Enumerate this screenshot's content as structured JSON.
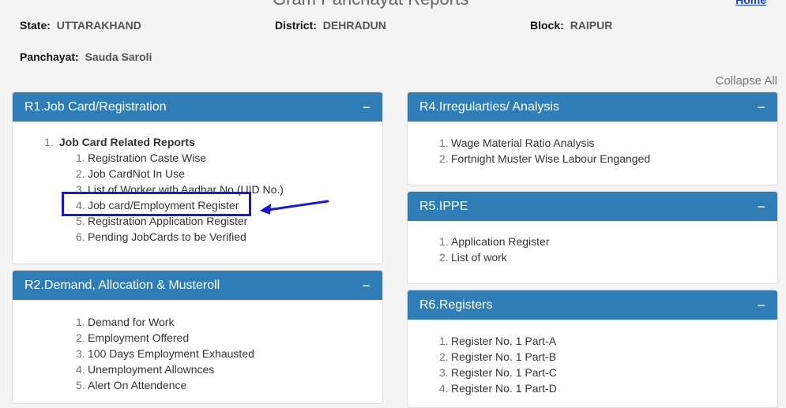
{
  "header": {
    "title": "Gram Panchayat Reports",
    "home_label": "Home"
  },
  "info": {
    "state_label": "State:",
    "state_value": "UTTARAKHAND",
    "district_label": "District:",
    "district_value": "DEHRADUN",
    "block_label": "Block:",
    "block_value": "RAIPUR",
    "panchayat_label": "Panchayat:",
    "panchayat_value": "Sauda Saroli"
  },
  "collapse_all_label": "Collapse All",
  "panels": {
    "r1": {
      "title": "R1.Job Card/Registration",
      "toggle": "−",
      "group": {
        "num": "1.",
        "title": "Job Card Related Reports"
      },
      "items": [
        {
          "num": "1.",
          "label": "Registration Caste Wise"
        },
        {
          "num": "2.",
          "label": "Job CardNot In Use"
        },
        {
          "num": "3.",
          "label": "List of Worker with Aadhar No.(UID No.)"
        },
        {
          "num": "4.",
          "label": "Job card/Employment Register"
        },
        {
          "num": "5.",
          "label": "Registration Application Register"
        },
        {
          "num": "6.",
          "label": "Pending JobCards to be Verified"
        }
      ]
    },
    "r2": {
      "title": "R2.Demand, Allocation & Musteroll",
      "toggle": "−",
      "items": [
        {
          "num": "1.",
          "label": "Demand for Work"
        },
        {
          "num": "2.",
          "label": "Employment Offered"
        },
        {
          "num": "3.",
          "label": "100 Days Employment Exhausted"
        },
        {
          "num": "4.",
          "label": "Unemployment Allownces"
        },
        {
          "num": "5.",
          "label": "Alert On Attendence"
        }
      ]
    },
    "r4": {
      "title": "R4.Irregularties/ Analysis",
      "toggle": "−",
      "items": [
        {
          "num": "1.",
          "label": "Wage Material Ratio Analysis"
        },
        {
          "num": "2.",
          "label": "Fortnight Muster Wise Labour Enganged"
        }
      ]
    },
    "r5": {
      "title": "R5.IPPE",
      "toggle": "−",
      "items": [
        {
          "num": "1.",
          "label": "Application Register"
        },
        {
          "num": "2.",
          "label": "List of work"
        }
      ]
    },
    "r6": {
      "title": "R6.Registers",
      "toggle": "−",
      "items": [
        {
          "num": "1.",
          "label": "Register No. 1 Part-A"
        },
        {
          "num": "2.",
          "label": "Register No. 1 Part-B"
        },
        {
          "num": "3.",
          "label": "Register No. 1 Part-C"
        },
        {
          "num": "4.",
          "label": "Register No. 1 Part-D"
        }
      ]
    }
  },
  "annotation_color": "#1717e0"
}
